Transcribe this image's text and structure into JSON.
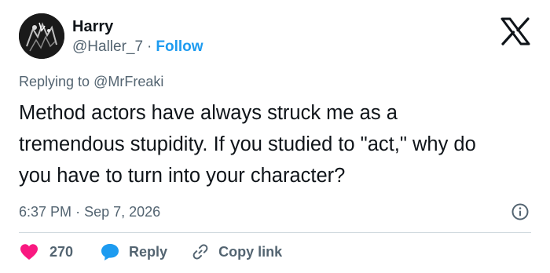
{
  "author": {
    "name": "Harry",
    "handle": "@Haller_7",
    "separator": "·",
    "follow_label": "Follow"
  },
  "reply_context": {
    "prefix": "Replying to",
    "mention": "@MrFreaki"
  },
  "tweet": {
    "text": "Method actors have always struck me as a tremendous stupidity. If you studied to \"act,\" why do you have to turn into your character?",
    "time": "6:37 PM",
    "separator": "·",
    "date": "Sep 7, 2026"
  },
  "actions": {
    "like_count": "270",
    "reply_label": "Reply",
    "copy_link_label": "Copy link"
  },
  "icons": {
    "logo": "x-logo-icon",
    "info": "info-icon",
    "like": "heart-icon",
    "reply": "speech-bubble-icon",
    "copy": "link-icon"
  },
  "colors": {
    "text": "#0f1419",
    "secondary": "#536471",
    "accent": "#1d9bf0",
    "like": "#f91880",
    "divider": "#cfd9de"
  }
}
